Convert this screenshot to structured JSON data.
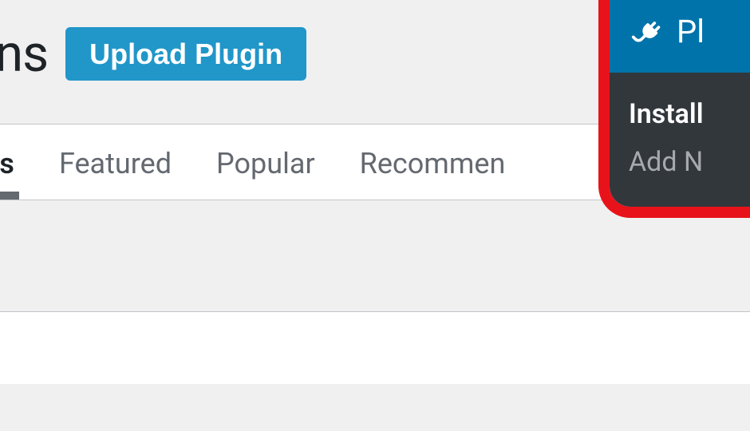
{
  "header": {
    "page_title_fragment": "ugins",
    "upload_button_label": "Upload Plugin"
  },
  "tabs": {
    "results_fragment": "esults",
    "featured": "Featured",
    "popular": "Popular",
    "recommended_fragment": "Recommen"
  },
  "callout": {
    "header_label_fragment": "Pl",
    "installed_fragment": "Install",
    "add_new_fragment": "Add N"
  }
}
